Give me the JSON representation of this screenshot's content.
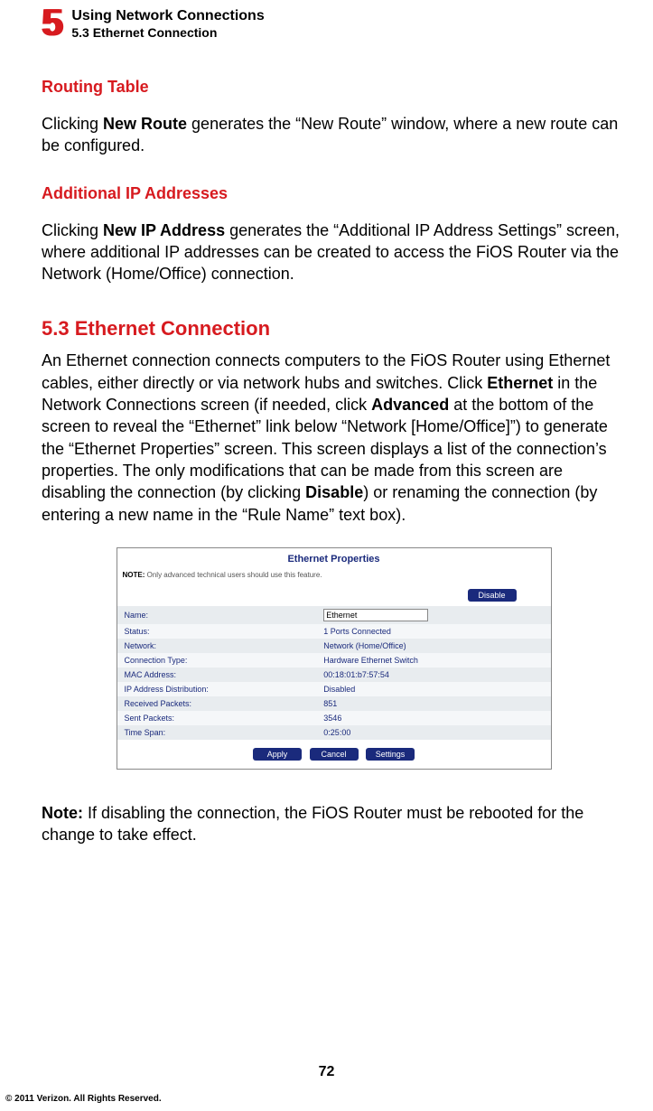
{
  "header": {
    "chapter_num": "5",
    "line1": "Using Network Connections",
    "line2": "5.3  Ethernet Connection"
  },
  "sections": {
    "routing_title": "Routing Table",
    "routing_text_pre": "Clicking ",
    "routing_text_bold": "New Route",
    "routing_text_post": " generates the “New Route” window, where a new route can be configured.",
    "addip_title": "Additional IP Addresses",
    "addip_text_pre": "Clicking ",
    "addip_text_bold": "New IP Address",
    "addip_text_post": " generates the “Additional IP Address Settings” screen, where additional IP addresses can be created to access the FiOS Router via the Network (Home/Office) connection.",
    "eth_head": "5.3  Ethernet Connection",
    "eth_para_parts": {
      "p1": "An Ethernet connection connects computers to the FiOS Router using Ethernet cables, either directly or via network hubs and switches. Click ",
      "b1": "Ethernet",
      "p2": " in the Network Connections screen (if needed, click ",
      "b2": "Advanced",
      "p3": " at the bottom of the screen to reveal the “Ethernet” link below “Network [Home/Office]”) to generate the “Ethernet Properties” screen. This screen displays a list of the connection’s properties. The only modifications that can be made from this screen are disabling the connection (by clicking ",
      "b3": "Disable",
      "p4": ") or renaming the connection (by entering a new name in the “Rule Name” text box)."
    },
    "note_bold": "Note:",
    "note_text": " If disabling the connection, the FiOS Router must be rebooted for the change to take effect."
  },
  "screenshot": {
    "title": "Ethernet Properties",
    "note_label": "NOTE:",
    "note_text": " Only advanced technical users should use this feature.",
    "disable_btn": "Disable",
    "name_value": "Ethernet",
    "rows": [
      {
        "label": "Name:",
        "value": ""
      },
      {
        "label": "Status:",
        "value": "1 Ports Connected"
      },
      {
        "label": "Network:",
        "value": "Network (Home/Office)"
      },
      {
        "label": "Connection Type:",
        "value": "Hardware Ethernet Switch"
      },
      {
        "label": "MAC Address:",
        "value": "00:18:01:b7:57:54"
      },
      {
        "label": "IP Address Distribution:",
        "value": "Disabled"
      },
      {
        "label": "Received Packets:",
        "value": "851"
      },
      {
        "label": "Sent Packets:",
        "value": "3546"
      },
      {
        "label": "Time Span:",
        "value": "0:25:00"
      }
    ],
    "buttons": {
      "apply": "Apply",
      "cancel": "Cancel",
      "settings": "Settings"
    }
  },
  "footer": {
    "page_num": "72",
    "copyright": "© 2011 Verizon. All Rights Reserved."
  }
}
